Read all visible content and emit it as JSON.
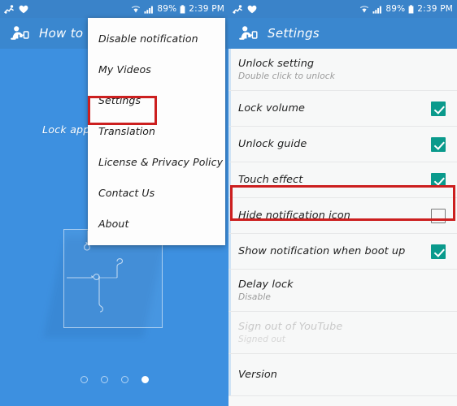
{
  "status_bar": {
    "left_icons": [
      "motion-icon",
      "heart-icon"
    ],
    "wifi_icon": "wifi-icon",
    "signal_icon": "signal-bars-icon",
    "battery_percent": "89%",
    "battery_icon": "battery-icon",
    "time": "2:39 PM"
  },
  "left_panel": {
    "app_icon": "crawling-baby-icon",
    "title": "How to use",
    "lock_app_label": "Lock app",
    "page_dots": [
      {
        "active": false
      },
      {
        "active": false
      },
      {
        "active": false
      },
      {
        "active": true
      }
    ]
  },
  "menu": {
    "items": [
      {
        "label": "Disable notification",
        "highlighted": false
      },
      {
        "label": "My Videos",
        "highlighted": false
      },
      {
        "label": "Settings",
        "highlighted": true
      },
      {
        "label": "Translation",
        "highlighted": false
      },
      {
        "label": "License & Privacy Policy",
        "highlighted": false
      },
      {
        "label": "Contact Us",
        "highlighted": false
      },
      {
        "label": "About",
        "highlighted": false
      }
    ]
  },
  "right_panel": {
    "app_icon": "crawling-baby-icon",
    "title": "Settings",
    "rows": [
      {
        "title": "Unlock setting",
        "subtitle": "Double click to unlock",
        "control": "none",
        "disabled": false,
        "highlighted": false
      },
      {
        "title": "Lock volume",
        "subtitle": "",
        "control": "checkbox",
        "checked": true,
        "disabled": false,
        "highlighted": false
      },
      {
        "title": "Unlock guide",
        "subtitle": "",
        "control": "checkbox",
        "checked": true,
        "disabled": false,
        "highlighted": true
      },
      {
        "title": "Touch effect",
        "subtitle": "",
        "control": "checkbox",
        "checked": true,
        "disabled": false,
        "highlighted": false
      },
      {
        "title": "Hide notification icon",
        "subtitle": "",
        "control": "checkbox",
        "checked": false,
        "disabled": false,
        "highlighted": false
      },
      {
        "title": "Show notification when boot up",
        "subtitle": "",
        "control": "checkbox",
        "checked": true,
        "disabled": false,
        "highlighted": false
      },
      {
        "title": "Delay lock",
        "subtitle": "Disable",
        "control": "none",
        "disabled": false,
        "highlighted": false
      },
      {
        "title": "Sign out of YouTube",
        "subtitle": "Signed out",
        "control": "none",
        "disabled": true,
        "highlighted": false
      },
      {
        "title": "Version",
        "subtitle": "",
        "control": "none",
        "disabled": false,
        "highlighted": false
      }
    ]
  },
  "colors": {
    "app_blue": "#3d90e0",
    "appbar_blue": "#3a87cf",
    "statusbar_blue": "#3a83c9",
    "highlight_red": "#cc1f1f",
    "checkbox_teal": "#0a9a8c",
    "list_bg": "#f7f8f8"
  }
}
